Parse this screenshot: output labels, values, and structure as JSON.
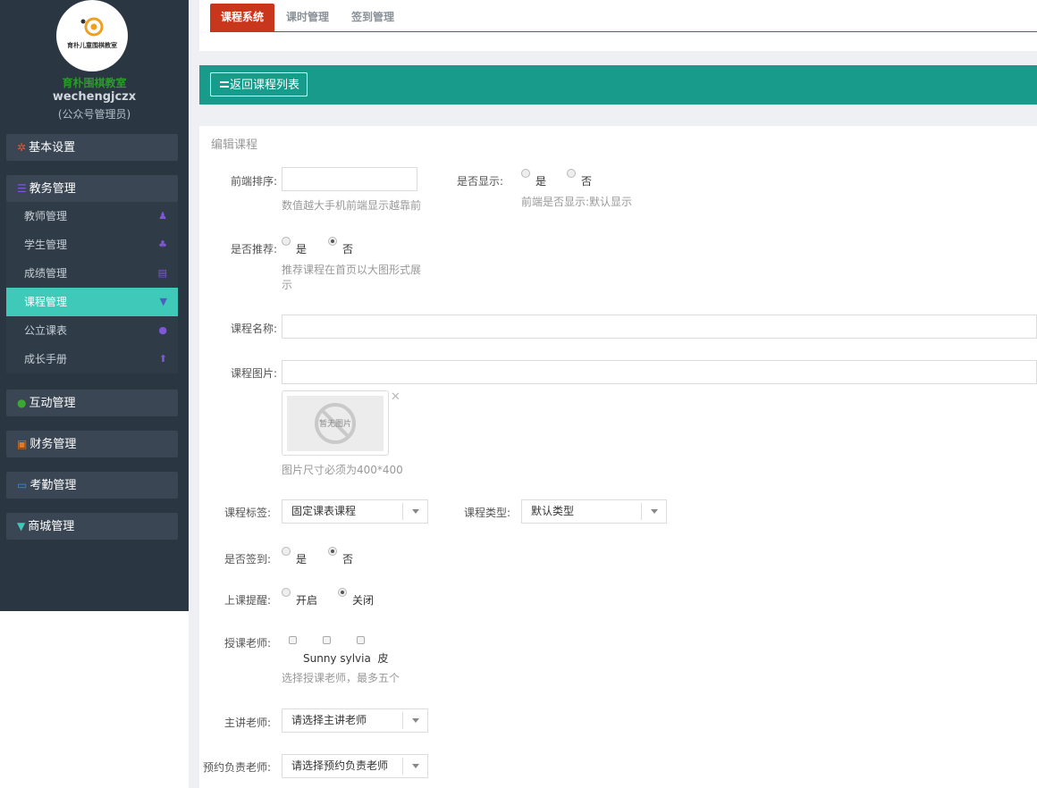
{
  "sidebar": {
    "logo_text": "育朴儿童围棋教室",
    "org_name": "育朴围棋教室",
    "username": "wechengjczx",
    "role": "(公众号管理员)",
    "groups": {
      "basic": {
        "label": "基本设置",
        "icon": "gear-icon",
        "color": "#e05a3a"
      },
      "academic": {
        "label": "教务管理",
        "icon": "list-icon",
        "color": "#7f57d8"
      },
      "interaction": {
        "label": "互动管理",
        "icon": "wechat-icon",
        "color": "#3aa832"
      },
      "finance": {
        "label": "财务管理",
        "icon": "money-icon",
        "color": "#e07a2a"
      },
      "attendance": {
        "label": "考勤管理",
        "icon": "card-icon",
        "color": "#3a8de0"
      },
      "mall": {
        "label": "商城管理",
        "icon": "cart-icon",
        "color": "#3ec9b8"
      }
    },
    "academic_items": [
      {
        "label": "教师管理",
        "icon": "user-icon"
      },
      {
        "label": "学生管理",
        "icon": "users-icon"
      },
      {
        "label": "成绩管理",
        "icon": "book-icon"
      },
      {
        "label": "课程管理",
        "icon": "graduation-cap-icon",
        "active": true
      },
      {
        "label": "公立课表",
        "icon": "globe-icon"
      },
      {
        "label": "成长手册",
        "icon": "arrow-up-icon"
      }
    ]
  },
  "tabs": [
    {
      "label": "课程系统",
      "active": true
    },
    {
      "label": "课时管理"
    },
    {
      "label": "签到管理"
    }
  ],
  "back_button": "返回课程列表",
  "form": {
    "title": "编辑课程",
    "sort_label": "前端排序:",
    "sort_hint": "数值越大手机前端显示越靠前",
    "show_label": "是否显示:",
    "show_yes": "是",
    "show_no": "否",
    "show_hint": "前端是否显示:默认显示",
    "recommend_label": "是否推荐:",
    "recommend_yes": "是",
    "recommend_no": "否",
    "recommend_hint_1": "推荐课程在首页以大图形式展",
    "recommend_hint_2": "示",
    "name_label": "课程名称:",
    "image_label": "课程图片:",
    "no_image_text": "暂无图片",
    "image_hint": "图片尺寸必须为400*400",
    "tag_label": "课程标签:",
    "tag_value": "固定课表课程",
    "type_label": "课程类型:",
    "type_value": "默认类型",
    "signin_label": "是否签到:",
    "signin_yes": "是",
    "signin_no": "否",
    "remind_label": "上课提醒:",
    "remind_on": "开启",
    "remind_off": "关闭",
    "teachers_label": "授课老师:",
    "teacher_names": "Sunny sylvia  皮",
    "teachers_hint": "选择授课老师，最多五个",
    "main_teacher_label": "主讲老师:",
    "main_teacher_value": "请选择主讲老师",
    "booking_teacher_label": "预约负责老师:",
    "booking_teacher_value": "请选择预约负责老师"
  }
}
